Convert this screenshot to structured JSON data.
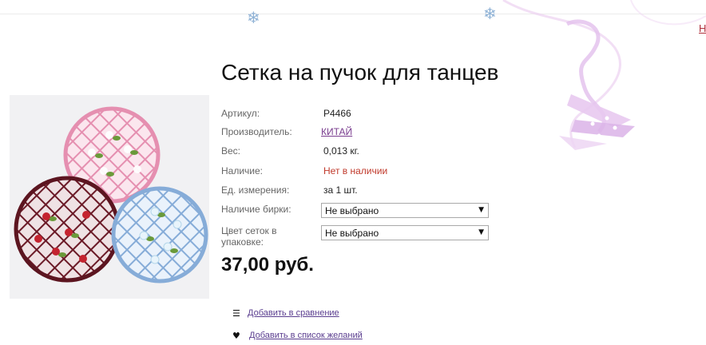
{
  "header": {
    "edge_link": "Н",
    "decor_icons": [
      "snowflake-icon",
      "snowflake-icon",
      "ribbon-decoration"
    ]
  },
  "product": {
    "title": "Сетка на пучок для танцев",
    "image_icon": "hair-net-photo",
    "specs": [
      {
        "label": "Артикул:",
        "value": "P4466"
      },
      {
        "label": "Производитель:",
        "value": "КИТАЙ"
      },
      {
        "label": "Вес:",
        "value": "0,013 кг."
      },
      {
        "label": "Наличие:",
        "value": "Нет в наличии"
      },
      {
        "label": "Ед. измерения:",
        "value": "за 1 шт."
      }
    ],
    "options": [
      {
        "label": "Наличие бирки:",
        "value": "Не выбрано"
      },
      {
        "label": "Цвет сеток в упаковке:",
        "value": "Не выбрано"
      }
    ],
    "price": "37,00 руб."
  },
  "actions": {
    "compare": {
      "icon": "list-icon",
      "label": "Добавить в сравнение"
    },
    "wishlist": {
      "icon": "heart-icon",
      "label": "Добавить в список желаний"
    }
  },
  "colors": {
    "out_of_stock": "#c0392b",
    "link": "#7a3d8f",
    "ribbon": "#e6c6ee",
    "net_pink": "#e89ab8",
    "net_maroon": "#6e1c28",
    "net_blue": "#8ab2dc"
  }
}
